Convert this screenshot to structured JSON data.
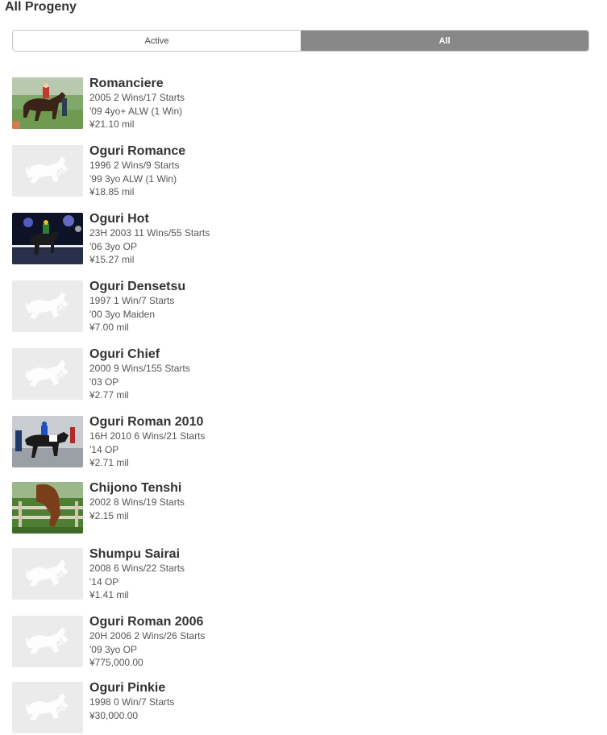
{
  "page": {
    "heading": "All Progeny"
  },
  "filter": {
    "tabs": [
      {
        "label": "Active",
        "selected": false
      },
      {
        "label": "All",
        "selected": true
      }
    ]
  },
  "no_image_label": "No image",
  "progeny": [
    {
      "name": "Romanciere",
      "lines": [
        "2005 2 Wins/17 Starts",
        "'09 4yo+ ALW (1 Win)",
        "¥21.10 mil"
      ],
      "thumb": "photo-paddock"
    },
    {
      "name": "Oguri Romance",
      "lines": [
        "1996 2 Wins/9 Starts",
        "'99 3yo ALW (1 Win)",
        "¥18.85 mil"
      ],
      "thumb": "no-image"
    },
    {
      "name": "Oguri Hot",
      "lines": [
        "23H 2003 11 Wins/55 Starts",
        "'06 3yo OP",
        "¥15.27 mil"
      ],
      "thumb": "photo-night"
    },
    {
      "name": "Oguri Densetsu",
      "lines": [
        "1997 1 Win/7 Starts",
        "'00 3yo Maiden",
        "¥7.00 mil"
      ],
      "thumb": "no-image"
    },
    {
      "name": "Oguri Chief",
      "lines": [
        "2000 9 Wins/155 Starts",
        "'03 OP",
        "¥2.77 mil"
      ],
      "thumb": "no-image"
    },
    {
      "name": "Oguri Roman 2010",
      "lines": [
        "16H 2010 6 Wins/21 Starts",
        "'14 OP",
        "¥2.71 mil"
      ],
      "thumb": "photo-snow"
    },
    {
      "name": "Chijono Tenshi",
      "lines": [
        "2002 8 Wins/19 Starts",
        "¥2.15 mil"
      ],
      "thumb": "photo-fence"
    },
    {
      "name": "Shumpu Sairai",
      "lines": [
        "2008 6 Wins/22 Starts",
        "'14 OP",
        "¥1.41 mil"
      ],
      "thumb": "no-image"
    },
    {
      "name": "Oguri Roman 2006",
      "lines": [
        "20H 2006 2 Wins/26 Starts",
        "'09 3yo OP",
        "¥775,000.00"
      ],
      "thumb": "no-image"
    },
    {
      "name": "Oguri Pinkie",
      "lines": [
        "1998 0 Win/7 Starts",
        "¥30,000.00"
      ],
      "thumb": "no-image"
    }
  ]
}
